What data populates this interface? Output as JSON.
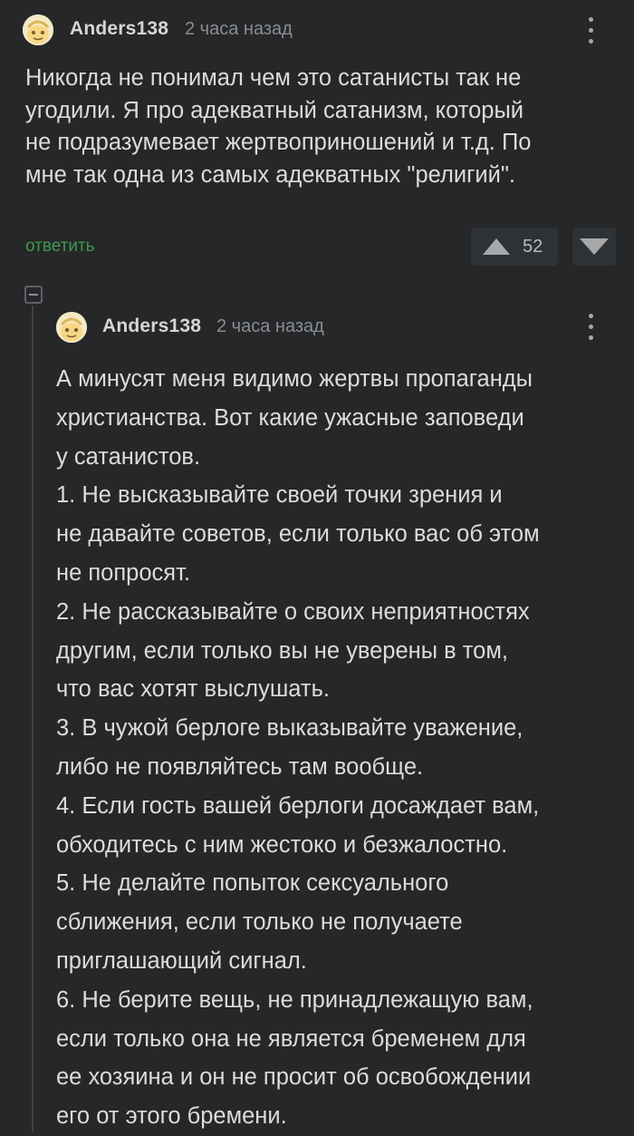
{
  "comments": [
    {
      "author": "Anders138",
      "time": "2 часа назад",
      "text": "Никогда не понимал чем это сатанисты так не\nугодили. Я про адекватный сатанизм, который\nне подразумевает жертвоприношений и т.д. По\nмне так одна из самых адекватных \"религий\".",
      "reply_label": "ответить",
      "rating": "52"
    },
    {
      "author": "Anders138",
      "time": "2 часа назад",
      "text": "А минусят меня видимо жертвы пропаганды\nхристианства. Вот какие ужасные заповеди\nу сатанистов.\n1. Не высказывайте своей точки зрения и\nне давайте советов, если только вас об этом\nне попросят.\n2. Не рассказывайте о своих неприятностях\nдругим, если только вы не уверены в том,\nчто вас хотят выслушать.\n3. В чужой берлоге выказывайте уважение,\nлибо не появляйтесь там вообще.\n4. Если гость вашей берлоги досаждает вам,\nобходитесь с ним жестоко и безжалостно.\n5. Не делайте попыток сексуального\nсближения, если только не получаете\nприглашающий сигнал.\n6. Не берите вещь, не принадлежащую вам,\nесли только она не является бременем для\nее хозяина и он не просит об освобождении\nего от этого бремени."
    }
  ],
  "icons": {
    "avatar": "avatar-icon",
    "more": "kebab-menu-icon",
    "upvote": "triangle-up-icon",
    "downvote": "triangle-down-icon",
    "collapse": "minus-square-icon"
  },
  "colors": {
    "background": "#252729",
    "reply_link": "#3f9a4e",
    "vote_box": "#2f3234"
  }
}
